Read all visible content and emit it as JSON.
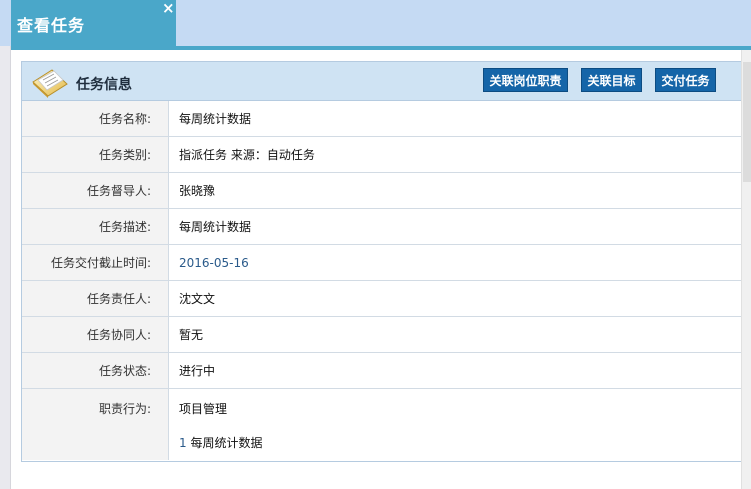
{
  "window": {
    "tab_title": "查看任务",
    "close_label": "×"
  },
  "panel": {
    "title": "任务信息",
    "icon": "folder-document-icon",
    "buttons": [
      {
        "label": "关联岗位职责"
      },
      {
        "label": "关联目标"
      },
      {
        "label": "交付任务"
      }
    ]
  },
  "fields": {
    "name": {
      "label": "任务名称:",
      "value": "每周统计数据"
    },
    "type": {
      "label": "任务类别:",
      "value": "指派任务 来源：自动任务"
    },
    "supervisor": {
      "label": "任务督导人:",
      "value": "张晓豫"
    },
    "description": {
      "label": "任务描述:",
      "value": "每周统计数据"
    },
    "deadline": {
      "label": "任务交付截止时间:",
      "value": "2016-05-16"
    },
    "owner": {
      "label": "任务责任人:",
      "value": "沈文文"
    },
    "collaborator": {
      "label": "任务协同人:",
      "value": "暂无"
    },
    "status": {
      "label": "任务状态:",
      "value": "进行中"
    },
    "duty": {
      "label": "职责行为:",
      "value": "项目管理",
      "sub_number": "1",
      "sub_text": "每周统计数据"
    }
  },
  "colors": {
    "tab_active": "#4aa7c9",
    "topbar": "#c5daf3",
    "panel_header": "#cfe3f3",
    "button": "#1565a8"
  }
}
